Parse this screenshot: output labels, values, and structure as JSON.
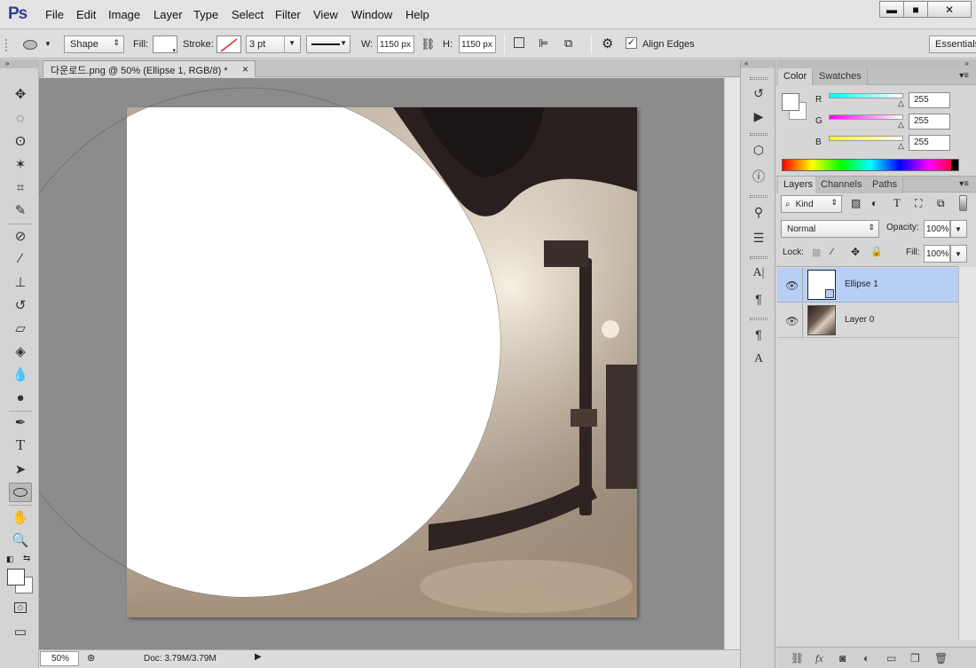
{
  "app": {
    "logo": "Ps"
  },
  "menu": [
    "File",
    "Edit",
    "Image",
    "Layer",
    "Type",
    "Select",
    "Filter",
    "View",
    "Window",
    "Help"
  ],
  "window_controls": {
    "minimize": "▬",
    "maximize": "■",
    "close": "✕"
  },
  "options": {
    "mode": "Shape",
    "fill_label": "Fill:",
    "stroke_label": "Stroke:",
    "stroke_width": "3 pt",
    "w_label": "W:",
    "w_value": "1150 px",
    "h_label": "H:",
    "h_value": "1150 px",
    "align_edges_label": "Align Edges",
    "workspace": "Essentials"
  },
  "document": {
    "tab_title": "다운로드.png @ 50% (Ellipse 1, RGB/8) *",
    "close": "×"
  },
  "status": {
    "zoom": "50%",
    "doc": "Doc: 3.79M/3.79M"
  },
  "color_panel": {
    "tabs": [
      "Color",
      "Swatches"
    ],
    "channels": [
      {
        "label": "R",
        "value": "255"
      },
      {
        "label": "G",
        "value": "255"
      },
      {
        "label": "B",
        "value": "255"
      }
    ]
  },
  "layers_panel": {
    "tabs": [
      "Layers",
      "Channels",
      "Paths"
    ],
    "kind": "Kind",
    "blend_mode": "Normal",
    "opacity_label": "Opacity:",
    "opacity": "100%",
    "lock_label": "Lock:",
    "fill_label": "Fill:",
    "fill": "100%",
    "layers": [
      {
        "name": "Ellipse 1",
        "selected": true
      },
      {
        "name": "Layer 0",
        "selected": false
      }
    ]
  },
  "colors": {
    "accent": "#3a3a8e",
    "selection": "#b7cef5",
    "canvas_bg": "#8c8c8c"
  }
}
